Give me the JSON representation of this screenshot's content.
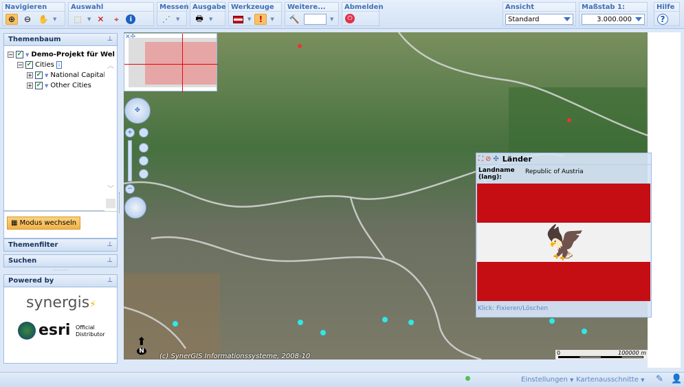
{
  "toolbar": {
    "navigieren": "Navigieren",
    "auswahl": "Auswahl",
    "messen": "Messen",
    "ausgabe": "Ausgabe",
    "werkzeuge": "Werkzeuge",
    "weitere": "Weitere...",
    "abmelden": "Abmelden",
    "ansicht": "Ansicht",
    "ansicht_value": "Standard",
    "massstab": "Maßstab 1:",
    "massstab_value": "3.000.000",
    "hilfe": "Hilfe",
    "hilfe_icon": "?"
  },
  "sidebar": {
    "themenbaum": "Themenbaum",
    "tree": [
      "Demo-Projekt für Wel",
      "Cities",
      "National Capital C",
      "Other Cities"
    ],
    "modus_button": "Modus wechseln",
    "themenfilter": "Themenfilter",
    "suchen": "Suchen",
    "powered_by": "Powered by",
    "logo_synergis": "synergis",
    "logo_esri": "esri",
    "logo_esri_sub": "Official Distributor"
  },
  "map": {
    "copyright": "(c) SynerGIS Informationssysteme, 2008-10",
    "scale_start": "0",
    "scale_end": "100000 m",
    "north": "N"
  },
  "popup": {
    "title": "Länder",
    "field_label": "Landname (lang):",
    "field_value": "Republic of Austria",
    "footer": "Klick: Fixieren/Löschen",
    "flag_colors": [
      "#d10f1a",
      "#ffffff",
      "#d10f1a"
    ]
  },
  "status": {
    "einstellungen": "Einstellungen",
    "kartenausschnitte": "Kartenausschnitte"
  }
}
